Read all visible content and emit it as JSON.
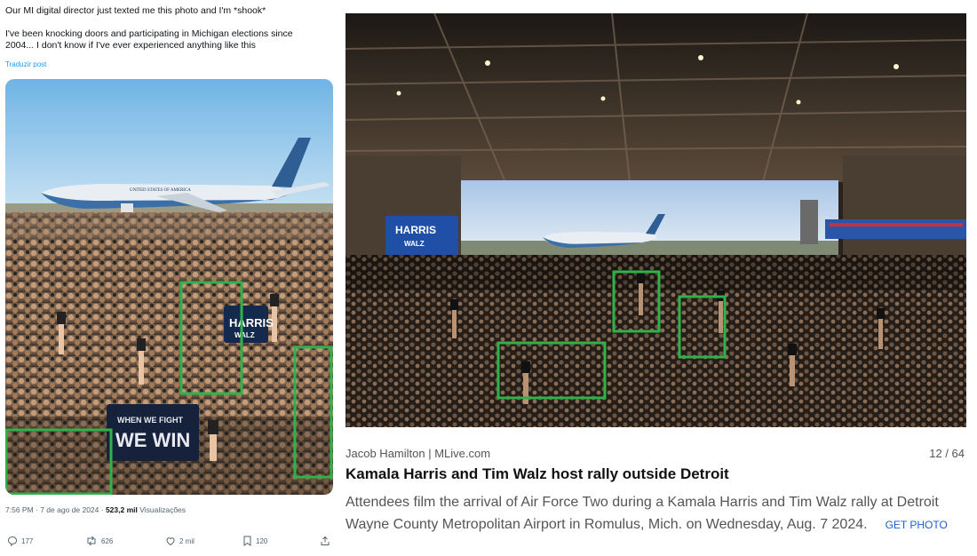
{
  "tweet": {
    "line1": "Our MI digital director just texted me this photo and I'm *shook*",
    "line2": "I've been knocking doors and participating in Michigan elections since",
    "line3": "2004... I don't know if I've ever experienced anything like this",
    "translate": "Traduzir post",
    "photo_sign_1": "HARRIS",
    "photo_sign_1b": "WALZ",
    "photo_sign_2a": "WHEN WE FIGHT",
    "photo_sign_2b": "WE WIN",
    "photo_plane_text": "UNITED STATES OF AMERICA",
    "meta_time": "7:56 PM · 7 de ago de 2024 · ",
    "meta_views_count": "523,2 mil",
    "meta_views_label": " Visualizações",
    "replies": "177",
    "reposts": "626",
    "likes": "2 mil",
    "bookmarks": "120"
  },
  "article": {
    "credit": "Jacob Hamilton | MLive.com",
    "counter": "12 / 64",
    "headline": "Kamala Harris and Tim Walz host rally outside Detroit",
    "caption": "Attendees film the arrival of Air Force Two during a Kamala Harris and Tim Walz rally at Detroit Wayne County Metropolitan Airport in Romulus, Mich. on Wednesday, Aug. 7 2024.",
    "get_photo": "GET PHOTO",
    "banner_left_1": "HARRIS",
    "banner_left_2": "WALZ"
  },
  "colors": {
    "highlight": "#2fb24a",
    "link": "#1d9bf0",
    "get_photo": "#1e5fc9"
  }
}
